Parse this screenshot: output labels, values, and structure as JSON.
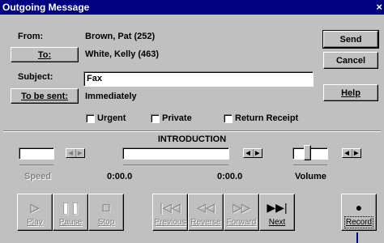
{
  "window": {
    "title": "Outgoing Message",
    "close_glyph": "×"
  },
  "header": {
    "from_label": "From:",
    "from_value": "Brown, Pat (252)",
    "to_button": "To:",
    "to_value": "White, Kelly (463)",
    "subject_label": "Subject:",
    "subject_value": "Fax",
    "tobesent_button": "To be sent:",
    "tobesent_value": "Immediately"
  },
  "side_buttons": {
    "send": "Send",
    "cancel": "Cancel",
    "help": "Help"
  },
  "options": {
    "urgent": "Urgent",
    "private": "Private",
    "return_receipt": "Return Receipt"
  },
  "player": {
    "section_title": "INTRODUCTION",
    "speed_label": "Speed",
    "volume_label": "Volume",
    "position_start": "0:00.0",
    "position_end": "0:00.0",
    "volume_level": 0.4
  },
  "transport": [
    {
      "name": "play-button",
      "label": "Play",
      "icon": "play-icon",
      "glyph": "▷",
      "enabled": false
    },
    {
      "name": "pause-button",
      "label": "Pause",
      "icon": "pause-icon",
      "glyph": "❚❚",
      "enabled": false
    },
    {
      "name": "stop-button",
      "label": "Stop",
      "icon": "stop-icon",
      "glyph": "□",
      "enabled": false
    },
    {
      "name": "previous-button",
      "label": "Previous",
      "icon": "previous-icon",
      "glyph": "|◁◁",
      "enabled": false
    },
    {
      "name": "reverse-button",
      "label": "Reverse",
      "icon": "reverse-icon",
      "glyph": "◁◁",
      "enabled": false
    },
    {
      "name": "forward-button",
      "label": "Forward",
      "icon": "forward-icon",
      "glyph": "▷▷",
      "enabled": false
    },
    {
      "name": "next-button",
      "label": "Next",
      "icon": "next-icon",
      "glyph": "▶▶|",
      "enabled": true
    },
    {
      "name": "record-button",
      "label": "Record",
      "icon": "record-icon",
      "glyph": "●",
      "enabled": true
    }
  ]
}
